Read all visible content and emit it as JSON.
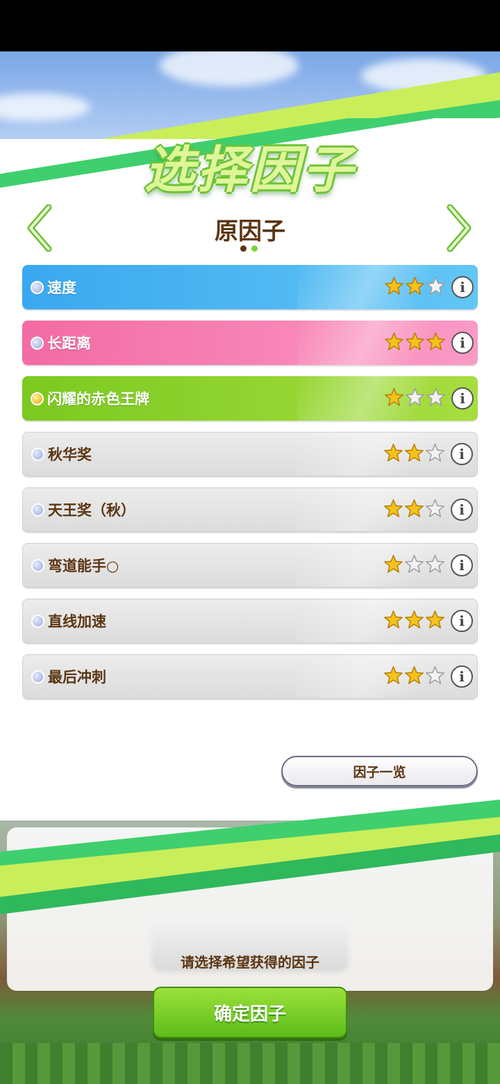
{
  "header": {
    "title": "选择因子",
    "section_title": "原因子",
    "page_dots": [
      false,
      true
    ]
  },
  "factors": [
    {
      "label": "速度",
      "color": "blue",
      "rating": 2,
      "max_rating": 3,
      "bullet": "blue"
    },
    {
      "label": "长距离",
      "color": "pink",
      "rating": 3,
      "max_rating": 3,
      "bullet": "blue"
    },
    {
      "label": "闪耀的赤色王牌",
      "color": "green",
      "rating": 1,
      "max_rating": 3,
      "bullet": "gold"
    },
    {
      "label": "秋华奖",
      "color": "gray",
      "rating": 2,
      "max_rating": 3,
      "bullet": "blue"
    },
    {
      "label": "天王奖（秋）",
      "color": "gray",
      "rating": 2,
      "max_rating": 3,
      "bullet": "blue"
    },
    {
      "label": "弯道能手○",
      "color": "gray",
      "rating": 1,
      "max_rating": 3,
      "bullet": "blue"
    },
    {
      "label": "直线加速",
      "color": "gray",
      "rating": 3,
      "max_rating": 3,
      "bullet": "blue"
    },
    {
      "label": "最后冲刺",
      "color": "gray",
      "rating": 2,
      "max_rating": 3,
      "bullet": "blue"
    }
  ],
  "info_label": "i",
  "actions": {
    "factor_list_label": "因子一览",
    "hint": "请选择希望获得的因子",
    "confirm_label": "确定因子"
  },
  "colors": {
    "accent_green": "#7bd133",
    "text_brown": "#5b3512",
    "star_gold": "#f5c21b"
  }
}
